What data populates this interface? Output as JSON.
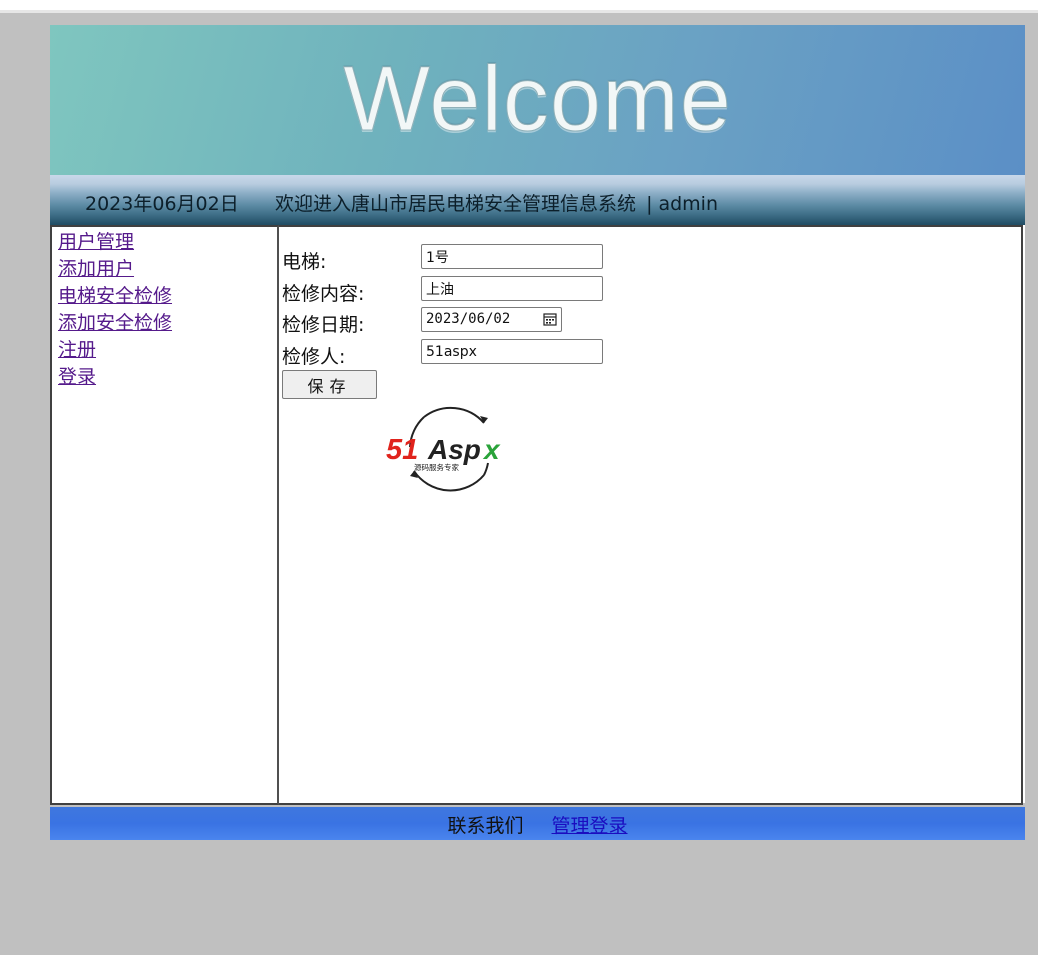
{
  "banner": {
    "title": "Welcome"
  },
  "infobar": {
    "date": "2023年06月02日",
    "welcome_text": "欢迎进入唐山市居民电梯安全管理信息系统",
    "separator": "|",
    "username": "admin"
  },
  "sidebar": {
    "items": [
      {
        "label": "用户管理"
      },
      {
        "label": "添加用户"
      },
      {
        "label": "电梯安全检修"
      },
      {
        "label": "添加安全检修"
      },
      {
        "label": "注册"
      },
      {
        "label": "登录"
      }
    ]
  },
  "form": {
    "elevator": {
      "label": "电梯:",
      "value": "1号"
    },
    "content": {
      "label": "检修内容:",
      "value": "上油"
    },
    "date": {
      "label": "检修日期:",
      "value": "2023/06/02"
    },
    "inspector": {
      "label": "检修人:",
      "value": "51aspx"
    },
    "save_label": "保存"
  },
  "logo": {
    "brand": "51Aspx",
    "tagline": "源码服务专家"
  },
  "footer": {
    "contact": "联系我们",
    "admin_login": "管理登录"
  },
  "colors": {
    "page_bg": "#c0c0c0",
    "link_visited": "#551a8b",
    "footer_bg": "#3f77de",
    "logo_red": "#e0231c",
    "logo_green": "#2aa33a"
  }
}
